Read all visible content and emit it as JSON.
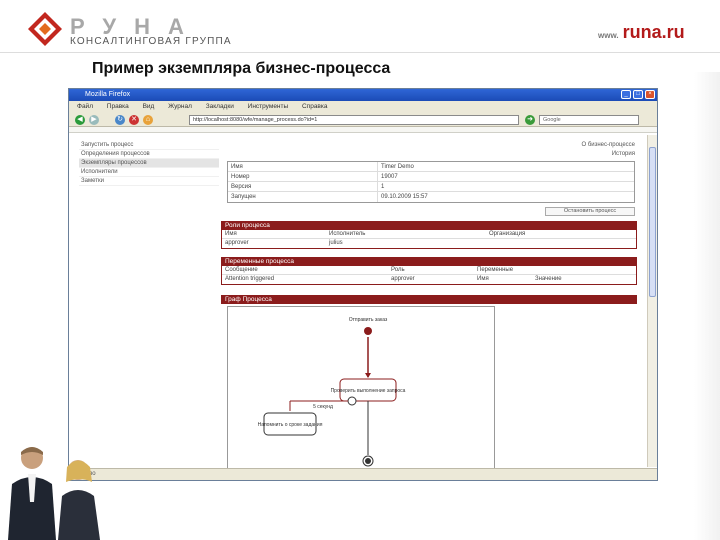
{
  "slide": {
    "logo_letters": "РУНА",
    "logo_subtitle": "КОНСАЛТИНГОВАЯ ГРУППА",
    "site_prefix": "www.",
    "site": "runa.ru",
    "title": "Пример экземпляра бизнес-процесса"
  },
  "browser": {
    "title": "Mozilla Firefox",
    "menu": [
      "Файл",
      "Правка",
      "Вид",
      "Журнал",
      "Закладки",
      "Инструменты",
      "Справка"
    ],
    "address": "http://localhost:8080/wfe/manage_process.do?id=1",
    "search_placeholder": "Google",
    "status": "Готово"
  },
  "sidebar": {
    "items": [
      "Запустить процесс",
      "Определения процессов",
      "Экземпляры процессов",
      "Исполнители",
      "Заметки"
    ],
    "active_index": 2
  },
  "toplinks": [
    "О бизнес-процессе",
    "История"
  ],
  "process_info": [
    {
      "key": "Имя",
      "value": "Timer Demo"
    },
    {
      "key": "Номер",
      "value": "19007"
    },
    {
      "key": "Версия",
      "value": "1"
    },
    {
      "key": "Запущен",
      "value": "09.10.2009 15:57"
    }
  ],
  "stop_button": "Остановить процесс",
  "roles": {
    "header": "Роли процесса",
    "columns": [
      "Имя",
      "Исполнитель",
      "Организация"
    ],
    "rows": [
      [
        "approver",
        "julius",
        ""
      ]
    ]
  },
  "variables": {
    "header": "Переменные процесса",
    "columns": [
      "Сообщение",
      "Роль",
      "Переменные"
    ],
    "subcolumns": [
      "Имя",
      "Значение"
    ],
    "rows": [
      [
        "Attention triggered",
        "approver",
        ""
      ]
    ]
  },
  "graph": {
    "header": "Граф Процесса",
    "start_label": "Отправить заказ",
    "task_label": "Проверить выполнение запроса",
    "timer_label": "5 секунд",
    "side_task_label": "Напомнить о сроке задания"
  }
}
